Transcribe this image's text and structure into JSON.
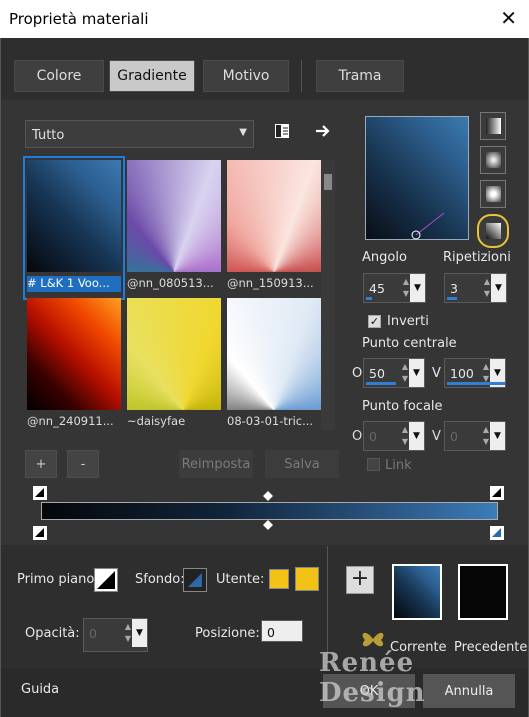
{
  "window": {
    "title": "Proprietà materiali",
    "close": "✕"
  },
  "tabs": [
    "Colore",
    "Gradiente",
    "Motivo",
    "Trama"
  ],
  "filter": {
    "value": "Tutto"
  },
  "gradients": [
    {
      "name": "# L&K 1 Voo..."
    },
    {
      "name": "@nn_080513..."
    },
    {
      "name": "@nn_150913..."
    },
    {
      "name": "@nn_240911..."
    },
    {
      "name": "~daisyfae"
    },
    {
      "name": "08-03-01-tric..."
    }
  ],
  "buttons": {
    "add": "+",
    "remove": "-",
    "reset": "Reimposta",
    "save": "Salva"
  },
  "angle": {
    "label": "Angolo",
    "value": "45"
  },
  "repeats": {
    "label": "Ripetizioni",
    "value": "3"
  },
  "invert": {
    "label": "Inverti",
    "checked": true
  },
  "center": {
    "label": "Punto centrale",
    "h_label": "O",
    "h": "50",
    "v_label": "V",
    "v": "100"
  },
  "focal": {
    "label": "Punto focale",
    "h_label": "O",
    "h": "0",
    "v_label": "V",
    "v": "0"
  },
  "link": {
    "label": "Link"
  },
  "foreground": {
    "label": "Primo piano:"
  },
  "background": {
    "label": "Sfondo:"
  },
  "user": {
    "label": "Utente:",
    "color1": "#f2c316",
    "color2": "#f2c316"
  },
  "opacity": {
    "label": "Opacità:",
    "value": "0"
  },
  "position": {
    "label": "Posizione:",
    "value": "0"
  },
  "current": {
    "label": "Corrente"
  },
  "previous": {
    "label": "Precedente"
  },
  "guide": "Guida",
  "ok": "OK",
  "cancel": "Annulla",
  "watermark": "Renée Design",
  "colors": {
    "selection": "#1e6fbf",
    "highlight_ring": "#e8c23a"
  }
}
